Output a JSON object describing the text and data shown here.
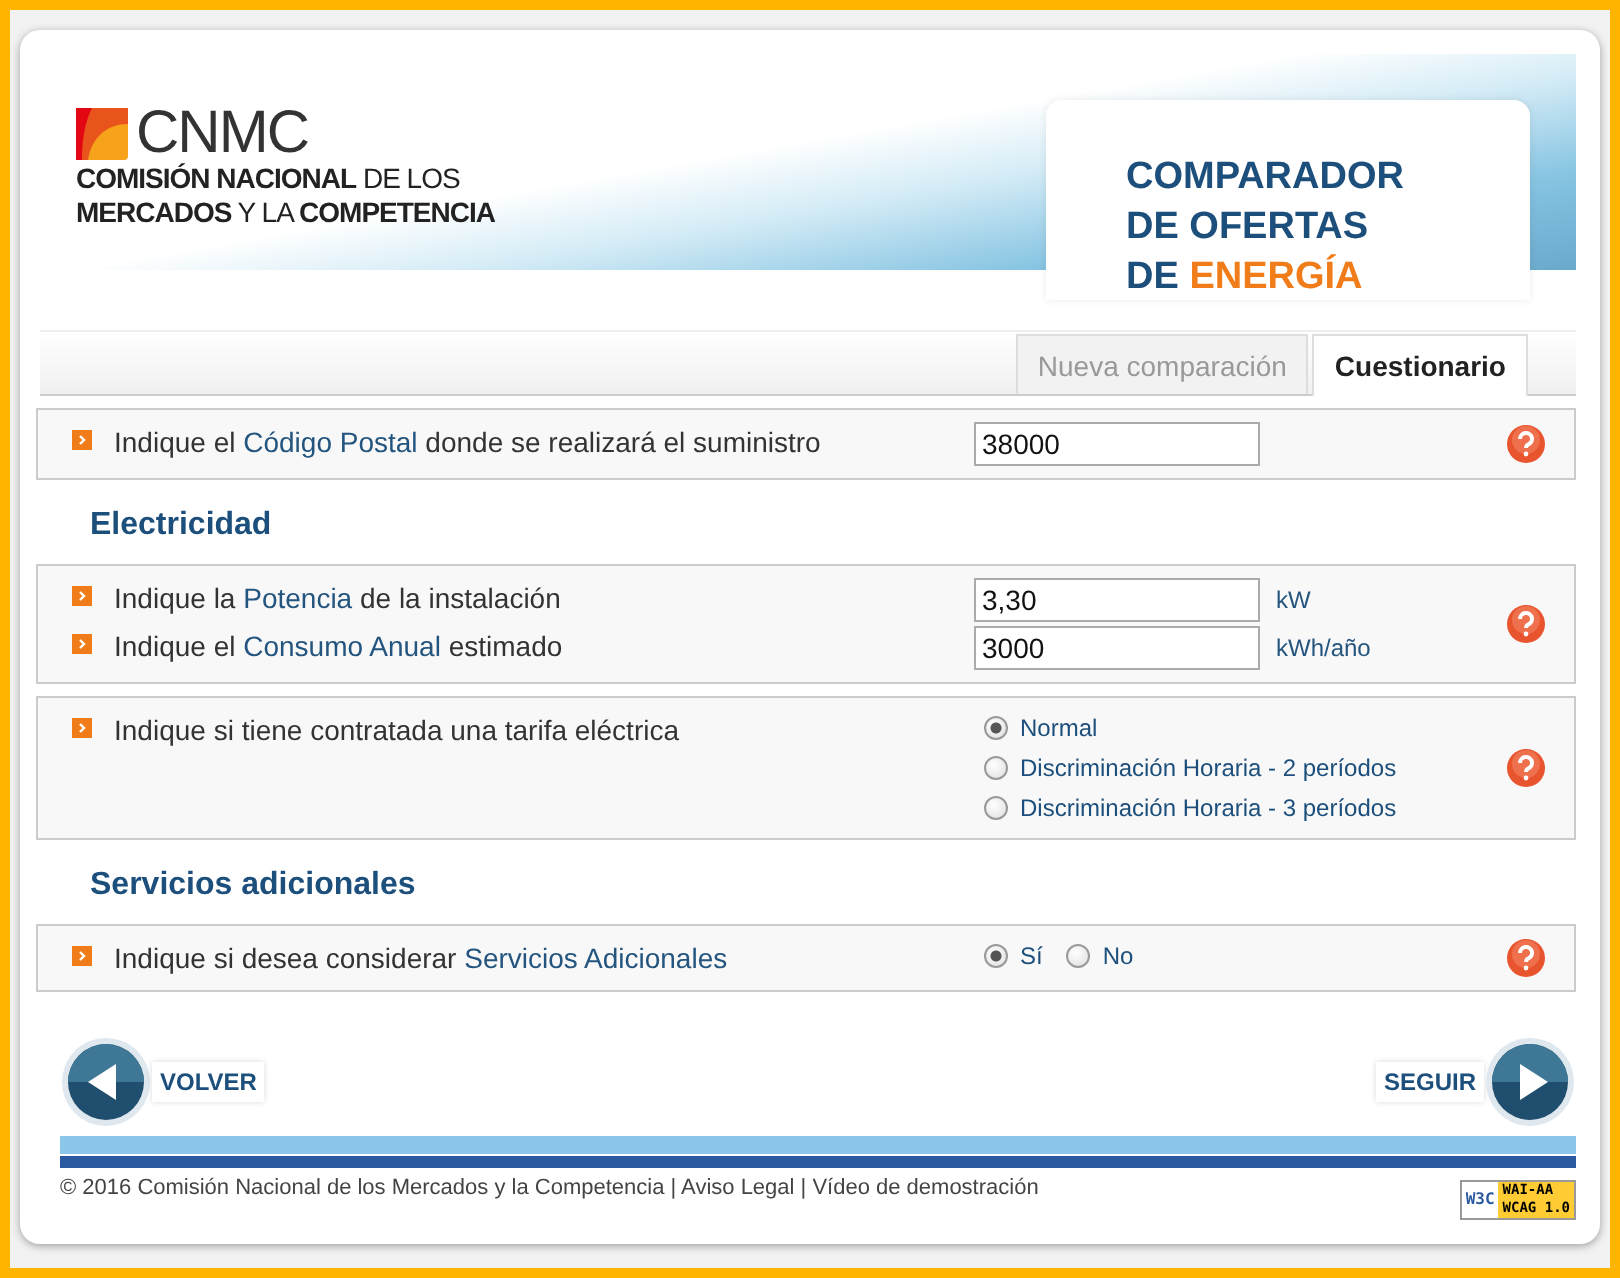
{
  "logo": {
    "wordmark": "CNMC",
    "lines": [
      "**COMISIÓN NACIONAL** DE LOS",
      "**MERCADOS** Y LA **COMPETENCIA**"
    ]
  },
  "title": {
    "lines": [
      [
        {
          "text": "COMPARADOR",
          "accent": false
        }
      ],
      [
        {
          "text": "DE OFERTAS",
          "accent": false
        }
      ],
      [
        {
          "text": "DE ",
          "accent": false
        },
        {
          "text": "ENERGÍA",
          "accent": true
        }
      ]
    ]
  },
  "tabs": [
    {
      "label": "Nueva comparación",
      "selected": false
    },
    {
      "label": "Cuestionario",
      "selected": true
    }
  ],
  "form": [
    {
      "kind": "panel",
      "questions": [
        {
          "kind": "text",
          "parts": [
            {
              "text": "Indique el ",
              "highlight": false
            },
            {
              "text": "Código Postal",
              "highlight": true
            },
            {
              "text": " donde se realizará el suministro",
              "highlight": false
            }
          ],
          "value": "38000"
        }
      ]
    },
    {
      "kind": "heading",
      "text": "Electricidad"
    },
    {
      "kind": "panel",
      "questions": [
        {
          "kind": "text",
          "parts": [
            {
              "text": "Indique la ",
              "highlight": false
            },
            {
              "text": "Potencia",
              "highlight": true
            },
            {
              "text": " de la instalación",
              "highlight": false
            }
          ],
          "value": "3,30",
          "unit": "kW"
        },
        {
          "kind": "text",
          "parts": [
            {
              "text": "Indique el ",
              "highlight": false
            },
            {
              "text": "Consumo Anual",
              "highlight": true
            },
            {
              "text": " estimado",
              "highlight": false
            }
          ],
          "value": "3000",
          "unit": "kWh/año"
        }
      ]
    },
    {
      "kind": "panel",
      "questions": [
        {
          "kind": "radio-list",
          "parts": [
            {
              "text": "Indique si tiene contratada una tarifa eléctrica",
              "highlight": false
            }
          ],
          "options": [
            {
              "label": "Normal",
              "selected": true
            },
            {
              "label": "Discriminación Horaria - 2 períodos",
              "selected": false
            },
            {
              "label": "Discriminación Horaria - 3 períodos",
              "selected": false
            }
          ]
        }
      ]
    },
    {
      "kind": "heading",
      "text": "Servicios adicionales"
    },
    {
      "kind": "panel",
      "questions": [
        {
          "kind": "radio-inline",
          "parts": [
            {
              "text": "Indique si desea considerar ",
              "highlight": false
            },
            {
              "text": "Servicios Adicionales",
              "highlight": true
            }
          ],
          "options": [
            {
              "label": "Sí",
              "selected": true
            },
            {
              "label": "No",
              "selected": false
            }
          ]
        }
      ]
    }
  ],
  "nav": {
    "back": "VOLVER",
    "next": "SEGUIR"
  },
  "footer": {
    "text": "© 2016 Comisión Nacional de los Mercados y la Competencia | Aviso Legal | Vídeo de demostración",
    "badge": {
      "left": "W3C",
      "top": "WAI-AA",
      "bottom": "WCAG 1.0"
    }
  }
}
